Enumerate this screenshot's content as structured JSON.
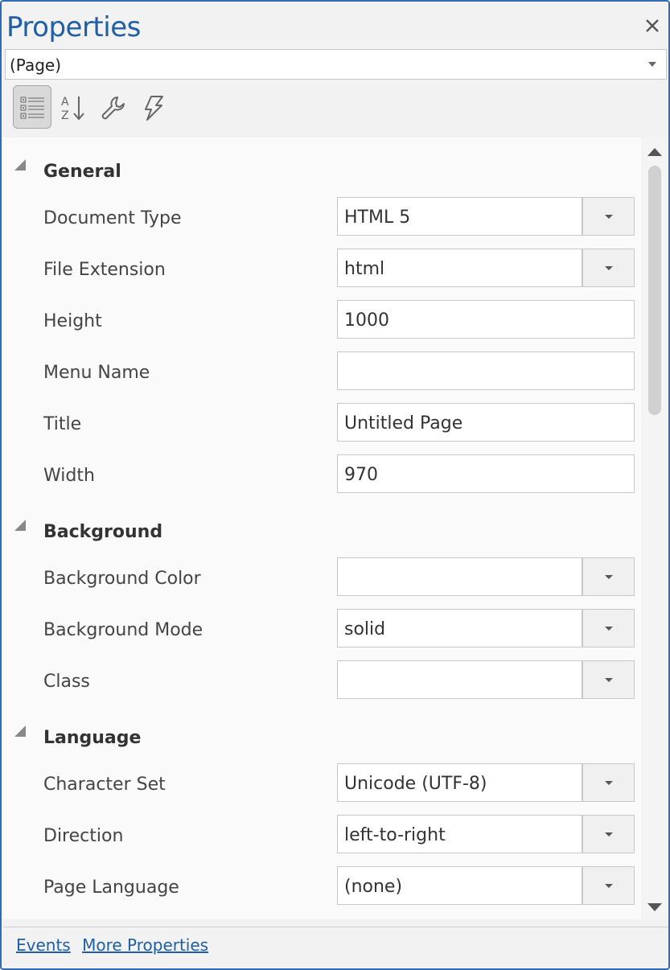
{
  "panel": {
    "title": "Properties",
    "object_selector": {
      "value": "(Page)"
    }
  },
  "toolbar": {
    "buttons": [
      {
        "icon": "categorized-icon",
        "active": true
      },
      {
        "icon": "sort-alphabetical-icon",
        "active": false
      },
      {
        "icon": "wrench-icon",
        "active": false
      },
      {
        "icon": "lightning-icon",
        "active": false
      }
    ]
  },
  "sections": [
    {
      "label": "General",
      "rows": [
        {
          "label": "Document Type",
          "value": "HTML 5",
          "dropdown": true
        },
        {
          "label": "File Extension",
          "value": "html",
          "dropdown": true
        },
        {
          "label": "Height",
          "value": "1000",
          "dropdown": false
        },
        {
          "label": "Menu Name",
          "value": "",
          "dropdown": false
        },
        {
          "label": "Title",
          "value": "Untitled Page",
          "dropdown": false
        },
        {
          "label": "Width",
          "value": "970",
          "dropdown": false
        }
      ]
    },
    {
      "label": "Background",
      "rows": [
        {
          "label": "Background Color",
          "value": "",
          "dropdown": true
        },
        {
          "label": "Background Mode",
          "value": "solid",
          "dropdown": true
        },
        {
          "label": "Class",
          "value": "",
          "dropdown": true
        }
      ]
    },
    {
      "label": "Language",
      "rows": [
        {
          "label": "Character Set",
          "value": "Unicode (UTF-8)",
          "dropdown": true
        },
        {
          "label": "Direction",
          "value": "left-to-right",
          "dropdown": true
        },
        {
          "label": "Page Language",
          "value": "(none)",
          "dropdown": true
        }
      ]
    }
  ],
  "footer": {
    "links": [
      "Events",
      "More Properties"
    ]
  },
  "colors": {
    "accent": "#1e5fa8",
    "border": "#2e6db4",
    "grid_bg": "#fafafa"
  }
}
